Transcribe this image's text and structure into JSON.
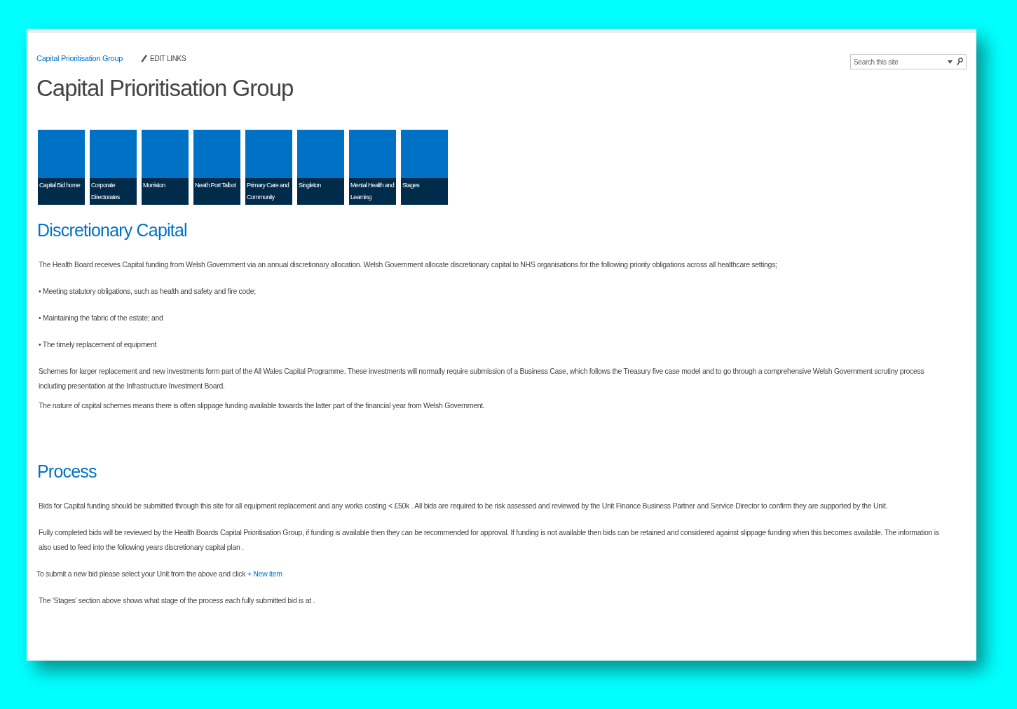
{
  "breadcrumb": {
    "site_link": "Capital Prioritisation Group",
    "edit_links": "EDIT LINKS"
  },
  "search": {
    "placeholder": "Search this site"
  },
  "page_title": "Capital Prioritisation Group",
  "tiles": [
    {
      "label": "Capital Bid home"
    },
    {
      "label": "Corporate Directorates"
    },
    {
      "label": "Morriston"
    },
    {
      "label": "Neath Port Talbot"
    },
    {
      "label": "Primary Care and Community"
    },
    {
      "label": "Singleton"
    },
    {
      "label": "Mental Health and Learning"
    },
    {
      "label": "Stages"
    }
  ],
  "sections": [
    {
      "heading": "Discretionary Capital",
      "paragraphs": [
        {
          "kind": "text",
          "text": "The Health Board receives Capital funding from Welsh Government via an annual discretionary allocation.  Welsh Government allocate discretionary capital to NHS organisations for the following priority obligations across all healthcare settings;"
        },
        {
          "kind": "bullet",
          "text": "• Meeting statutory obligations, such as health and safety and fire code;"
        },
        {
          "kind": "bullet",
          "text": "• Maintaining the fabric of the estate; and"
        },
        {
          "kind": "bullet",
          "text": "• The timely replacement of equipment"
        },
        {
          "kind": "tight",
          "text": "Schemes for larger replacement and new investments form part of the All Wales Capital Programme. These investments will normally require submission of a Business Case, which follows the Treasury five case model and to go through a comprehensive Welsh Government scrutiny process including presentation at the Infrastructure Investment Board."
        },
        {
          "kind": "tight",
          "text": "The nature of capital schemes means there is often slippage funding available towards the latter part of the financial year from Welsh Government."
        }
      ]
    },
    {
      "heading": "Process",
      "paragraphs": [
        {
          "kind": "text",
          "text": "Bids for Capital funding should be submitted through this site for all equipment replacement  and any works costing < £50k . All bids are required to be risk assessed and reviewed by the Unit Finance Business Partner and Service Director to confirm they are supported by the Unit."
        },
        {
          "kind": "text",
          "text": "Fully completed bids will be reviewed by the Health Boards Capital Prioritisation Group, if funding is available then they can be recommended for approval.  If funding is not available then bids can be retained and considered against slippage funding when this becomes available. The information is also used to feed into the following years discretionary capital plan ."
        },
        {
          "kind": "link",
          "text": "To submit a new bid please select your Unit from the above and click ",
          "link": "+ New item"
        },
        {
          "kind": "text",
          "text": "The 'Stages' section above shows what stage of the process each fully submitted bid is at ."
        }
      ]
    }
  ]
}
